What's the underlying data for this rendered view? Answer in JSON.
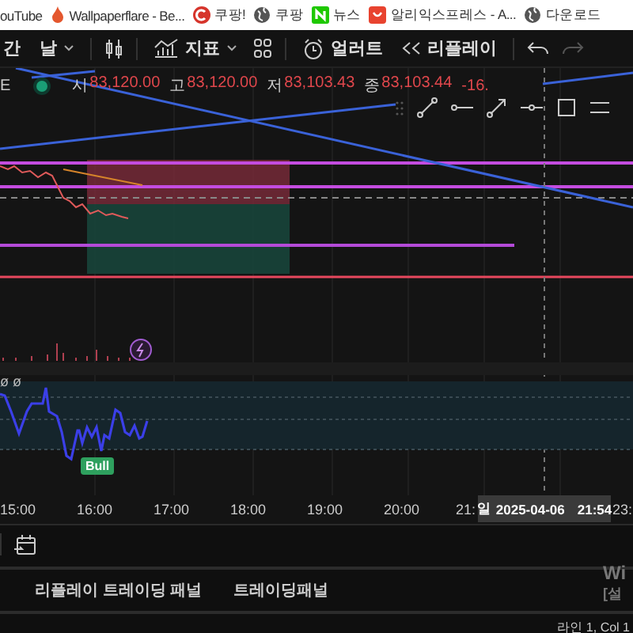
{
  "bookmarks": [
    {
      "kind": "none",
      "label": "ouTube"
    },
    {
      "kind": "flame",
      "label": "Wallpaperflare - Be..."
    },
    {
      "kind": "letter-c",
      "label": "쿠팡!"
    },
    {
      "kind": "globe",
      "label": "쿠팡"
    },
    {
      "kind": "letter-n",
      "label": "뉴스"
    },
    {
      "kind": "bag",
      "label": "알리익스프레스 - A..."
    },
    {
      "kind": "globe",
      "label": "다운로드"
    }
  ],
  "toolbar": {
    "interval": "간",
    "interval_value": "날",
    "indicators": "지표",
    "alert": "얼러트",
    "replay": "리플레이"
  },
  "legend": {
    "symbol": "E",
    "fields": [
      {
        "label": "시",
        "value": "83,120.00"
      },
      {
        "label": "고",
        "value": "83,120.00"
      },
      {
        "label": "저",
        "value": "83,103.43"
      },
      {
        "label": "종",
        "value": "83,103.44"
      }
    ],
    "change": "-16."
  },
  "indicator_legend": "ø ø",
  "signal": "Bull",
  "time_axis": [
    "15:00",
    "16:00",
    "17:00",
    "18:00",
    "19:00",
    "20:00",
    "21:",
    "23:"
  ],
  "crosshair": {
    "day": "일",
    "date": "2025-04-06",
    "time": "21:54"
  },
  "panel_tabs": [
    "리플레이 트레이딩 패널",
    "트레이딩패널"
  ],
  "os_notice": [
    "Wi",
    "[설"
  ],
  "status": "라인 1, Col 1"
}
